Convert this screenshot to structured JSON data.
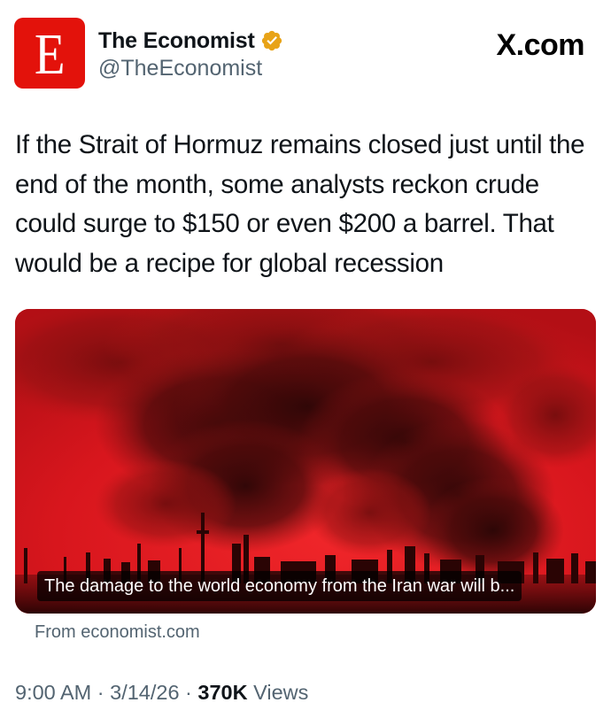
{
  "author": {
    "avatar_letter": "E",
    "display_name": "The Economist",
    "handle": "@TheEconomist",
    "verified": true,
    "verified_color": "#e8a317",
    "avatar_color": "#e3120b"
  },
  "brand": {
    "label": "X.com"
  },
  "tweet": {
    "text": "If the Strait of Hormuz remains closed just until the end of the month, some analysts reckon crude could surge to $150 or even $200 a barrel. That would be a recipe for global recession"
  },
  "link_card": {
    "image_description_icon": "smoke-plume-image",
    "caption": "The damage to the world economy from the Iran war will b...",
    "source": "From economist.com"
  },
  "meta": {
    "time": "9:00 AM",
    "separator1": " · ",
    "date": "3/14/26",
    "separator2": " · ",
    "views_count": "370K",
    "views_label": " Views"
  }
}
